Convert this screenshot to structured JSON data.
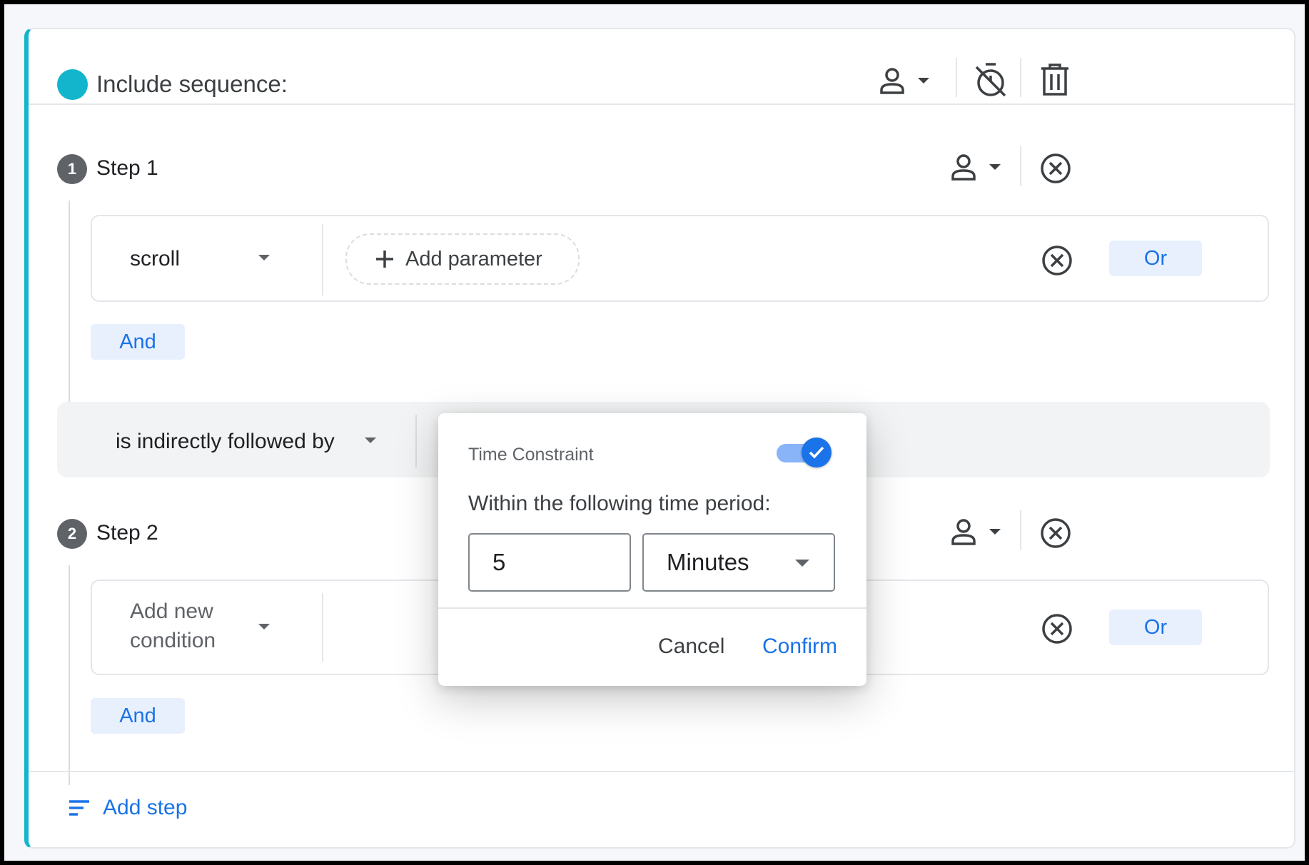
{
  "header": {
    "title": "Include sequence:"
  },
  "step1": {
    "number": "1",
    "label": "Step 1",
    "condition_event": "scroll",
    "add_parameter_label": "Add parameter",
    "or_label": "Or",
    "and_label": "And"
  },
  "followed": {
    "label": "is indirectly followed by"
  },
  "step2": {
    "number": "2",
    "label": "Step 2",
    "condition_placeholder_line1": "Add new",
    "condition_placeholder_line2": "condition",
    "or_label": "Or",
    "and_label": "And"
  },
  "footer": {
    "add_step_label": "Add step"
  },
  "dialog": {
    "title": "Time Constraint",
    "toggle_on": true,
    "subtitle": "Within the following time period:",
    "duration_value": "5",
    "unit_value": "Minutes",
    "cancel_label": "Cancel",
    "confirm_label": "Confirm"
  },
  "colors": {
    "accent": "#1a73e8",
    "teal": "#12b5cb",
    "chip_bg": "#e8f0fe"
  },
  "icons": {
    "person": "person-icon",
    "timer_off": "timer-off-icon",
    "trash": "trash-icon",
    "close_circle": "close-circle-icon",
    "plus": "plus-icon",
    "sort_lines": "add-step-lines-icon",
    "checkmark": "check-icon"
  }
}
